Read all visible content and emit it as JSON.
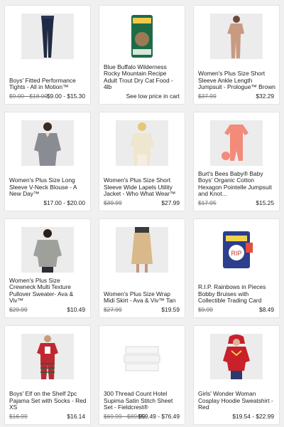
{
  "products": [
    {
      "title": "Boys' Fitted Performance Tights - All in Motion™",
      "original_price": "$9.00 - $18.00",
      "price": "$9.00 - $15.30",
      "image_icon": "navy-tights-image"
    },
    {
      "title": "Blue Buffalo Wilderness Rocky Mountain Recipe Adult Trout Dry Cat Food - 4lb",
      "original_price": "",
      "price": "See low price in cart",
      "image_icon": "cat-food-bag-image"
    },
    {
      "title": "Women's Plus Size Short Sleeve Ankle Length Jumpsuit - Prologue™ Brown",
      "original_price": "$37.99",
      "price": "$32.29",
      "image_icon": "jumpsuit-image"
    },
    {
      "title": "Women's Plus Size Long Sleeve V-Neck Blouse - A New Day™",
      "original_price": "",
      "price": "$17.00 - $20.00",
      "image_icon": "blouse-image"
    },
    {
      "title": "Women's Plus Size Short Sleeve Wide Lapels Utility Jacket - Who What Wear™",
      "original_price": "$39.99",
      "price": "$27.99",
      "image_icon": "utility-jacket-image"
    },
    {
      "title": "Burt's Bees Baby® Baby Boys' Organic Cotton Hexagon Pointelle Jumpsuit and Knot...",
      "original_price": "$17.95",
      "price": "$15.25",
      "image_icon": "baby-jumpsuit-image"
    },
    {
      "title": "Women's Plus Size Crewneck Multi Texture Pullover Sweater- Ava & Viv™",
      "original_price": "$29.99",
      "price": "$10.49",
      "image_icon": "sweater-image"
    },
    {
      "title": "Women's Plus Size Wrap Midi Skirt - Ava & Viv™ Tan",
      "original_price": "$27.99",
      "price": "$19.59",
      "image_icon": "midi-skirt-image"
    },
    {
      "title": "R.I.P. Rainbows in Pieces Bobby Bruises with Collectible Trading Card",
      "original_price": "$9.99",
      "price": "$8.49",
      "image_icon": "toy-package-image"
    },
    {
      "title": "Boys' Elf on the Shelf 2pc Pajama Set with Socks - Red XS",
      "original_price": "$16.99",
      "price": "$16.14",
      "image_icon": "pajama-set-image"
    },
    {
      "title": "300 Thread Count Hotel Supima Satin Stitch Sheet Set - Fieldcrest®",
      "original_price": "$69.99 - $89.99",
      "price": "$59.49 - $76.49",
      "image_icon": "sheet-set-image"
    },
    {
      "title": "Girls' Wonder Woman Cosplay Hoodie Sweatshirt - Red",
      "original_price": "",
      "price": "$19.54 - $22.99",
      "image_icon": "hoodie-image"
    }
  ],
  "colors": {
    "card_bg": "#ffffff",
    "page_bg": "#f0f0f0",
    "strike": "#777777"
  }
}
